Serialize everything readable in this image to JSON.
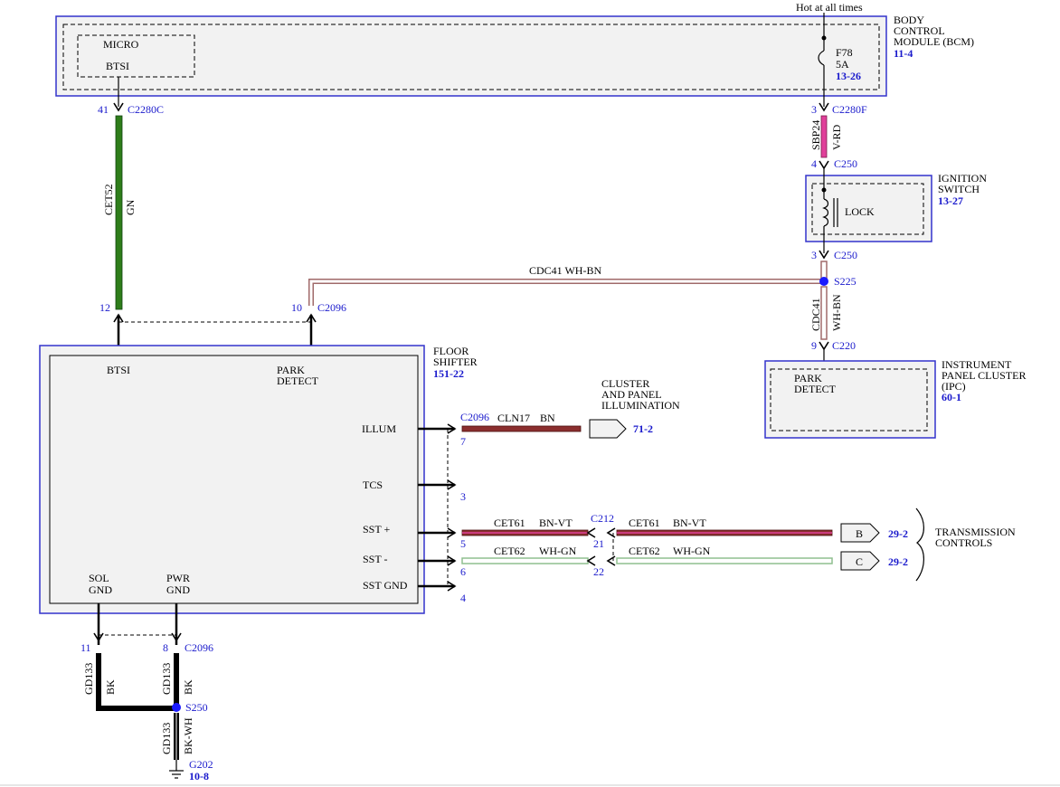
{
  "hot_label": "Hot at all times",
  "bcm": {
    "title_lines": [
      "BODY",
      "CONTROL",
      "MODULE (BCM)"
    ],
    "ref": "11-4",
    "micro_label": "MICRO",
    "btsi_label": "BTSI",
    "fuse_name": "F78",
    "fuse_amps": "5A",
    "fuse_ref": "13-26"
  },
  "c2280c": {
    "pin": "41",
    "name": "C2280C"
  },
  "c2280f": {
    "pin": "3",
    "name": "C2280F"
  },
  "wire_cet52": {
    "circuit": "CET52",
    "color_code": "GN"
  },
  "wire_sbp24": {
    "circuit": "SBP24",
    "color_code": "V-RD"
  },
  "c250_top": {
    "pin": "4",
    "name": "C250"
  },
  "ignition": {
    "title_lines": [
      "IGNITION",
      "SWITCH"
    ],
    "ref": "13-27",
    "lock_label": "LOCK"
  },
  "c250_bottom": {
    "pin": "3",
    "name": "C250"
  },
  "wire_cdc41_h": {
    "label": "CDC41    WH-BN"
  },
  "s225": {
    "name": "S225"
  },
  "wire_cdc41_v": {
    "circuit": "CDC41",
    "color_code": "WH-BN"
  },
  "c220": {
    "pin": "9",
    "name": "C220"
  },
  "ipc": {
    "title_lines": [
      "INSTRUMENT",
      "PANEL CLUSTER",
      "(IPC)"
    ],
    "ref": "60-1",
    "park_lines": [
      "PARK",
      "DETECT"
    ]
  },
  "c2096_top": {
    "pin_btsi": "12",
    "pin_park": "10",
    "name": "C2096"
  },
  "floor_shifter": {
    "title_lines": [
      "FLOOR",
      "SHIFTER"
    ],
    "ref": "151-22",
    "btsi_label": "BTSI",
    "park_lines": [
      "PARK",
      "DETECT"
    ],
    "pins": {
      "illum": "ILLUM",
      "tcs": "TCS",
      "sst_plus": "SST +",
      "sst_minus": "SST -",
      "sst_gnd": "SST GND"
    },
    "sol_lines": [
      "SOL",
      "GND"
    ],
    "pwr_lines": [
      "PWR",
      "GND"
    ]
  },
  "c2096_right": {
    "name": "C2096",
    "pin_illum": "7",
    "pin_tcs": "3",
    "pin_sst_plus": "5",
    "pin_sst_minus": "6",
    "pin_sst_gnd": "4"
  },
  "wire_cln17": {
    "circuit": "CLN17",
    "color_code": "BN"
  },
  "cluster_illum": {
    "title_lines": [
      "CLUSTER",
      "AND PANEL",
      "ILLUMINATION"
    ],
    "ref": "71-2"
  },
  "c212": {
    "name": "C212",
    "pin_top": "21",
    "pin_bottom": "22"
  },
  "wire_cet61_left": {
    "circuit": "CET61",
    "color_code": "BN-VT"
  },
  "wire_cet61_right": {
    "circuit": "CET61",
    "color_code": "BN-VT"
  },
  "wire_cet62_left": {
    "circuit": "CET62",
    "color_code": "WH-GN"
  },
  "wire_cet62_right": {
    "circuit": "CET62",
    "color_code": "WH-GN"
  },
  "trans": {
    "arrow_b": "B",
    "arrow_c": "C",
    "ref_b": "29-2",
    "ref_c": "29-2",
    "title_lines": [
      "TRANSMISSION",
      "CONTROLS"
    ]
  },
  "c2096_bottom": {
    "pin_sol": "11",
    "pin_pwr": "8",
    "name": "C2096"
  },
  "wire_gd133_left": {
    "circuit": "GD133",
    "color_code": "BK"
  },
  "wire_gd133_mid": {
    "circuit": "GD133",
    "color_code": "BK"
  },
  "wire_gd133_bottom": {
    "circuit": "GD133",
    "color_code": "BK-WH"
  },
  "s250": {
    "name": "S250"
  },
  "g202": {
    "name": "G202",
    "ref": "10-8"
  },
  "colors": {
    "module_outline": "#3333cc",
    "label_blue": "#1a1acc",
    "wire_green": "#2e7d1a",
    "wire_violet_red": "#e0409a",
    "wire_white_brown": "#a06a6a",
    "wire_brown": "#8b2e2e",
    "wire_white_green": "#8fbf8f"
  }
}
